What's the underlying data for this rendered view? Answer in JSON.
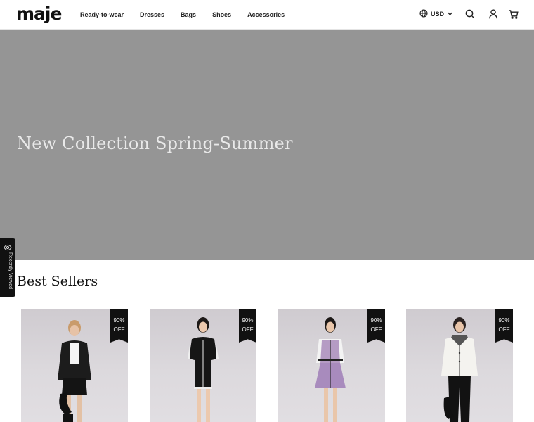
{
  "header": {
    "logo": "maje",
    "nav": [
      "Ready-to-wear",
      "Dresses",
      "Bags",
      "Shoes",
      "Accessories"
    ],
    "currency": "USD",
    "icons": [
      "globe-icon",
      "chevron-down-icon",
      "search-icon",
      "account-icon",
      "cart-icon"
    ]
  },
  "hero": {
    "title": "New Collection Spring-Summer",
    "background_color": "#959595"
  },
  "recently_viewed": {
    "label": "Recently Viewed",
    "icon": "eye-icon"
  },
  "best_sellers": {
    "title": "Best Sellers",
    "products": [
      {
        "badge_top": "90%",
        "badge_bottom": "OFF",
        "outfit": "black tweed jacket with white top, black shorts and boots"
      },
      {
        "badge_top": "90%",
        "badge_bottom": "OFF",
        "outfit": "black knit dress with white trim"
      },
      {
        "badge_top": "90%",
        "badge_bottom": "OFF",
        "outfit": "lilac tweed dress with white shirt"
      },
      {
        "badge_top": "90%",
        "badge_bottom": "OFF",
        "outfit": "white tweed jacket with black flared trousers"
      }
    ]
  },
  "colors": {
    "badge": "#111111",
    "hero_text": "#e9e9e9",
    "header_border": "#e4e4e4"
  }
}
